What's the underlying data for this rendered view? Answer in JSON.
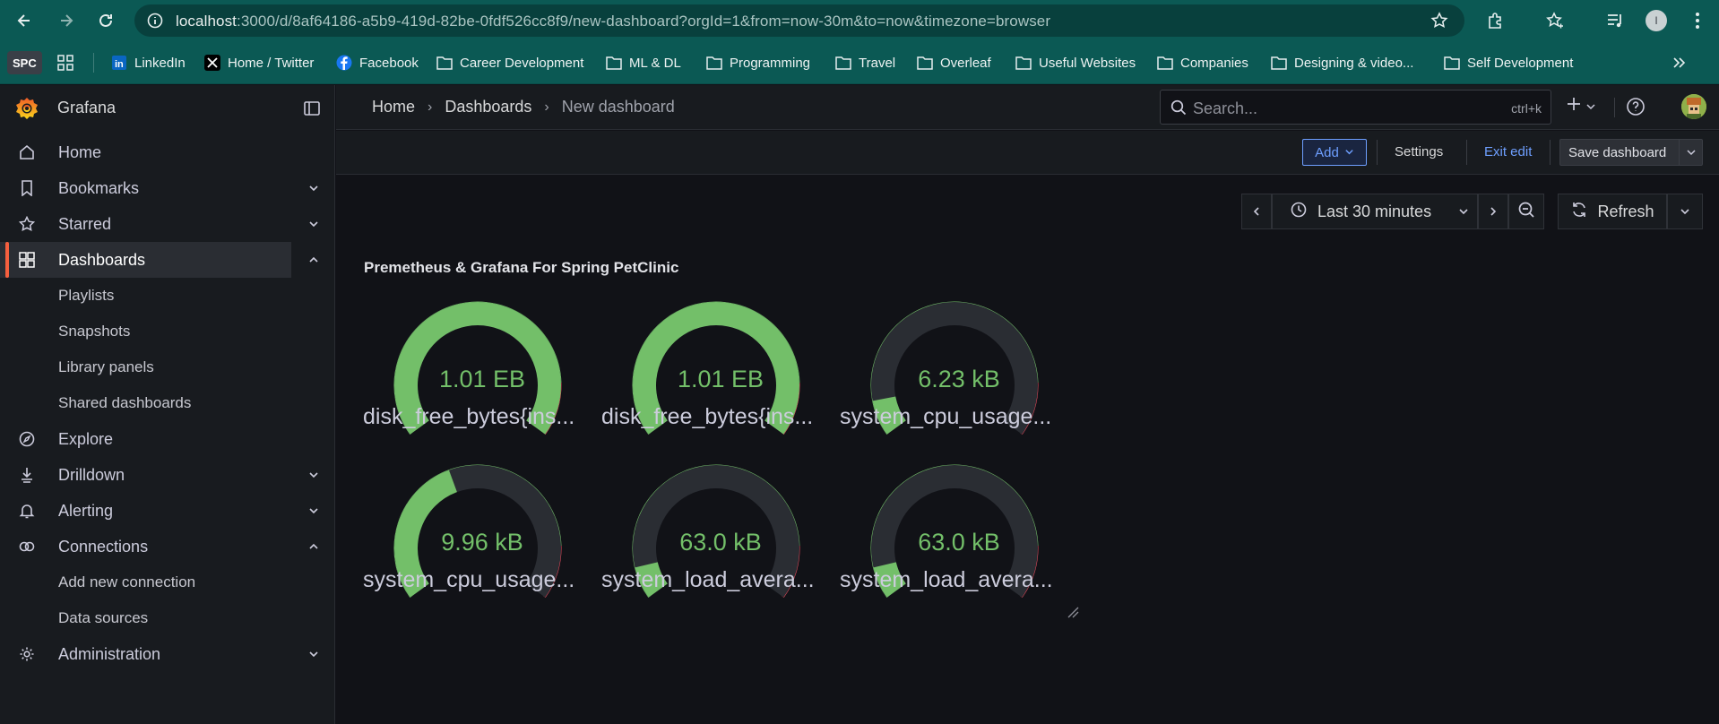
{
  "browser": {
    "url_host": "localhost",
    "url_rest": ":3000/d/8af64186-a5b9-419d-82be-0fdf526cc8f9/new-dashboard?orgId=1&from=now-30m&to=now&timezone=browser",
    "profile_initial": "I"
  },
  "bookmarks": {
    "spc": "SPC",
    "items": [
      {
        "label": "LinkedIn",
        "icon": "linkedin-icon"
      },
      {
        "label": "Home / Twitter",
        "icon": "x-icon"
      },
      {
        "label": "Facebook",
        "icon": "facebook-icon"
      },
      {
        "label": "Career Development",
        "icon": "folder-icon"
      },
      {
        "label": "ML & DL",
        "icon": "folder-icon"
      },
      {
        "label": "Programming",
        "icon": "folder-icon"
      },
      {
        "label": "Travel",
        "icon": "folder-icon"
      },
      {
        "label": "Overleaf",
        "icon": "folder-icon"
      },
      {
        "label": "Useful Websites",
        "icon": "folder-icon"
      },
      {
        "label": "Companies",
        "icon": "folder-icon"
      },
      {
        "label": "Designing & video...",
        "icon": "folder-icon"
      },
      {
        "label": "Self Development",
        "icon": "folder-icon"
      }
    ]
  },
  "sidebar": {
    "brand": "Grafana",
    "items": [
      {
        "label": "Home"
      },
      {
        "label": "Bookmarks"
      },
      {
        "label": "Starred"
      },
      {
        "label": "Dashboards"
      },
      {
        "label": "Playlists"
      },
      {
        "label": "Snapshots"
      },
      {
        "label": "Library panels"
      },
      {
        "label": "Shared dashboards"
      },
      {
        "label": "Explore"
      },
      {
        "label": "Drilldown"
      },
      {
        "label": "Alerting"
      },
      {
        "label": "Connections"
      },
      {
        "label": "Add new connection"
      },
      {
        "label": "Data sources"
      },
      {
        "label": "Administration"
      }
    ]
  },
  "topbar": {
    "breadcrumbs": [
      "Home",
      "Dashboards",
      "New dashboard"
    ],
    "search_placeholder": "Search...",
    "search_shortcut": "ctrl+k"
  },
  "toolbar": {
    "add": "Add",
    "settings": "Settings",
    "exit_edit": "Exit edit",
    "save": "Save dashboard"
  },
  "time": {
    "range": "Last 30 minutes",
    "refresh": "Refresh"
  },
  "panel": {
    "title": "Premetheus & Grafana For Spring PetClinic",
    "gauges": [
      {
        "value": "1.01 EB",
        "label": "disk_free_bytes{ins...",
        "fill": 1.0
      },
      {
        "value": "1.01 EB",
        "label": "disk_free_bytes{ins...",
        "fill": 1.0
      },
      {
        "value": "6.23 kB",
        "label": "system_cpu_usage...",
        "fill": 0.1
      },
      {
        "value": "9.96 kB",
        "label": "system_cpu_usage...",
        "fill": 0.42
      },
      {
        "value": "63.0 kB",
        "label": "system_load_avera...",
        "fill": 0.09
      },
      {
        "value": "63.0 kB",
        "label": "system_load_avera...",
        "fill": 0.09
      }
    ]
  },
  "colors": {
    "gauge_fill": "#73bf69",
    "gauge_threshold_green": "#73bf69",
    "gauge_threshold_red": "#f2495c",
    "accent": "#f55f3e",
    "link": "#6e9fff"
  }
}
